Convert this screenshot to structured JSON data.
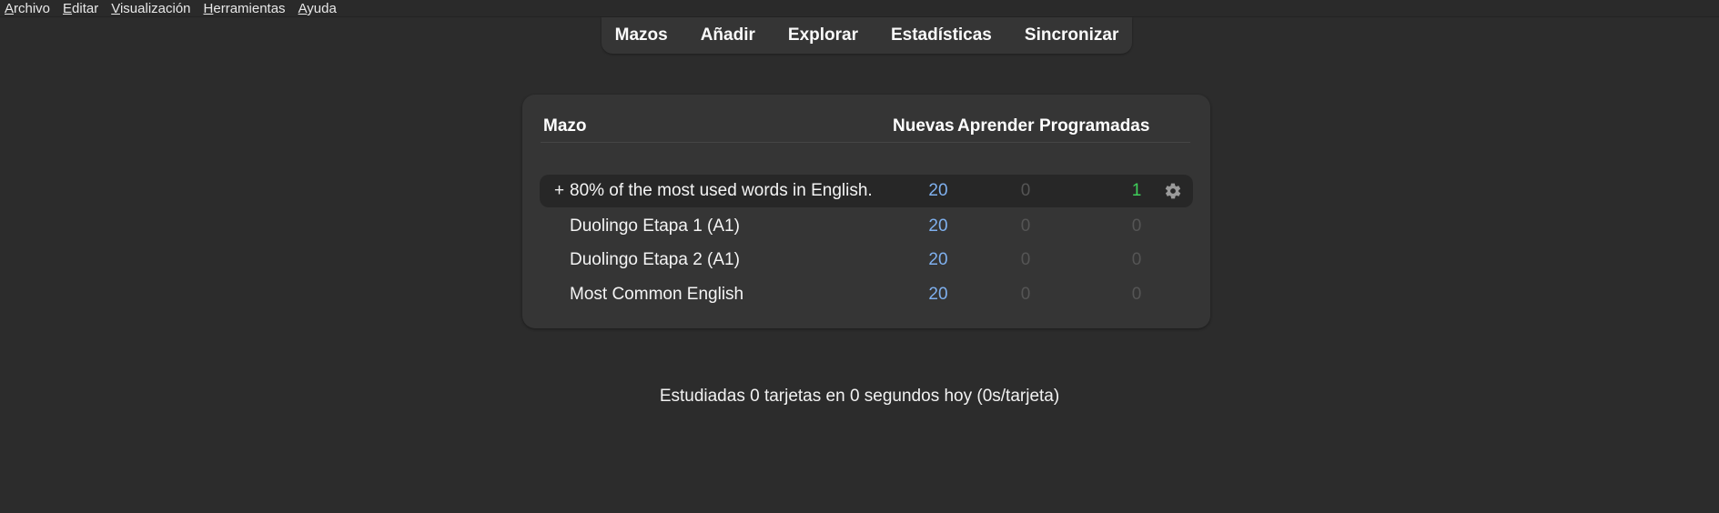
{
  "menubar": {
    "items": [
      {
        "first": "A",
        "rest": "rchivo"
      },
      {
        "first": "E",
        "rest": "ditar"
      },
      {
        "first": "V",
        "rest": "isualización"
      },
      {
        "first": "H",
        "rest": "erramientas"
      },
      {
        "first": "A",
        "rest": "yuda"
      }
    ]
  },
  "toolbar": {
    "decks": "Mazos",
    "add": "Añadir",
    "browse": "Explorar",
    "stats": "Estadísticas",
    "sync": "Sincronizar"
  },
  "deck_table": {
    "headers": {
      "deck": "Mazo",
      "new": "Nuevas",
      "learn": "Aprender",
      "due": "Programadas"
    },
    "rows": [
      {
        "collapse": "+",
        "name": "80% of the most used words in English.",
        "new": "20",
        "learn": "0",
        "due": "1",
        "gear_icon": "gear-icon"
      },
      {
        "collapse": "",
        "name": "Duolingo Etapa 1 (A1)",
        "new": "20",
        "learn": "0",
        "due": "0"
      },
      {
        "collapse": "",
        "name": "Duolingo Etapa 2 (A1)",
        "new": "20",
        "learn": "0",
        "due": "0"
      },
      {
        "collapse": "",
        "name": "Most Common English",
        "new": "20",
        "learn": "0",
        "due": "0"
      }
    ]
  },
  "study_stats": "Estudiadas 0 tarjetas en 0 segundos hoy (0s/tarjeta)",
  "colors": {
    "background": "#2c2c2c",
    "panel": "#353535",
    "new_count": "#7fb0ee",
    "due_count": "#3fcf5a",
    "zero_count": "#555555"
  }
}
